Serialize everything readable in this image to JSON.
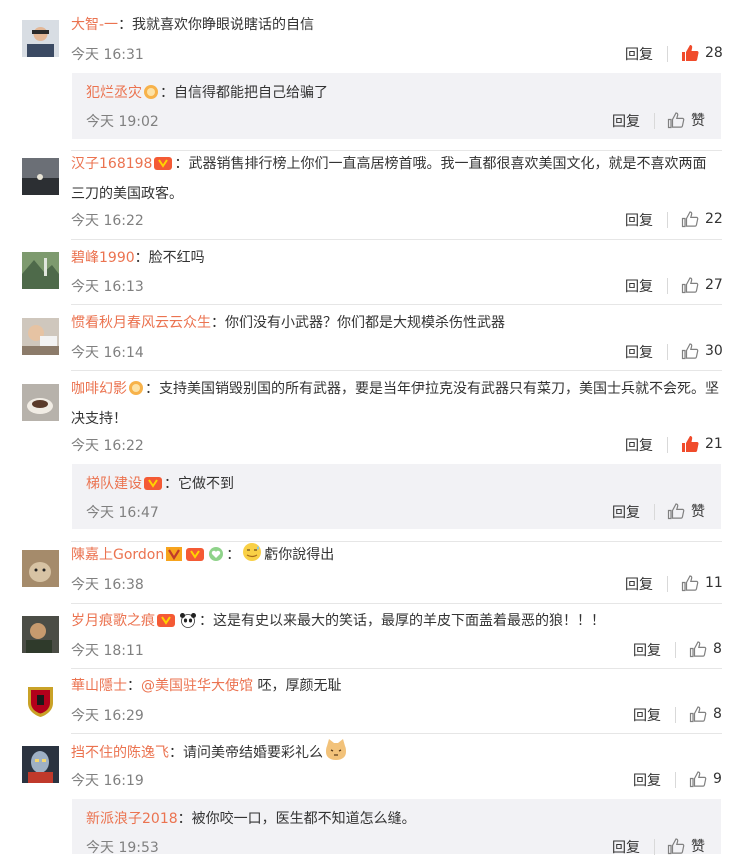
{
  "reply_label": "回复",
  "like_word": "赞",
  "colors": {
    "username": "#eb7350",
    "meta": "#808080",
    "liked": "#f04b2b",
    "sub_bg": "#f2f2f5"
  },
  "comments": [
    {
      "user": "大智-一",
      "text": "：我就喜欢你睁眼说瞎话的自信",
      "time": "今天 16:31",
      "likes": "28"
    },
    {
      "user": "汉子168198",
      "text": "：武器销售排行榜上你们一直高居榜首哦。我一直都很喜欢美国文化，就是不喜欢两面三刀的美国政客。",
      "time": "今天 16:22",
      "likes": "22"
    },
    {
      "user": "碧峰1990",
      "text": "：脸不红吗",
      "time": "今天 16:13",
      "likes": "27"
    },
    {
      "user": "惯看秋月春风云云众生",
      "text": "：你们没有小武器？你们都是大规模杀伤性武器",
      "time": "今天 16:14",
      "likes": "30"
    },
    {
      "user": "咖啡幻影",
      "text": "：支持美国销毁别国的所有武器，要是当年伊拉克没有武器只有菜刀，美国士兵就不会死。坚决支持！",
      "time": "今天 16:22",
      "likes": "21"
    },
    {
      "user": "陳嘉上Gordon",
      "text": "：",
      "text2": "虧你說得出",
      "time": "今天 16:38",
      "likes": "11"
    },
    {
      "user": "岁月痕歌之痕",
      "text": "：这是有史以来最大的笑话，最厚的羊皮下面盖着最恶的狼！！！",
      "time": "今天 18:11",
      "likes": "8"
    },
    {
      "user": "華山隱士",
      "text": "：",
      "mention": "@美国驻华大使馆",
      "text2": " 呸，厚颜无耻",
      "time": "今天 16:29",
      "likes": "8"
    },
    {
      "user": "挡不住的陈逸飞",
      "text": "：请问美帝结婚要彩礼么",
      "time": "今天 16:19",
      "likes": "9"
    }
  ],
  "subs": [
    {
      "user": "犯烂丞灾",
      "text": "：自信得都能把自己给骗了",
      "time": "今天 19:02"
    },
    {
      "user": "梯队建设",
      "text": "：它做不到",
      "time": "今天 16:47"
    },
    {
      "user": "新派浪子2018",
      "text": "：被你咬一口，医生都不知道怎么缝。",
      "time": "今天 19:53"
    }
  ]
}
